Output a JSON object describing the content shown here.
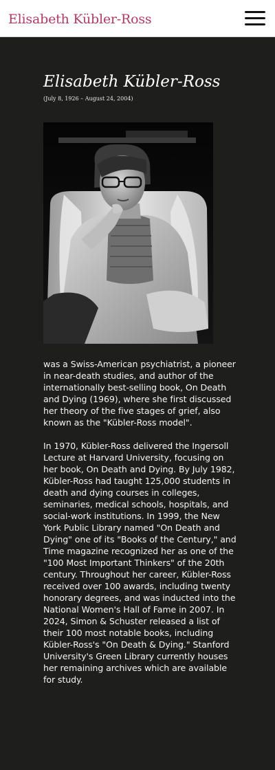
{
  "header": {
    "site_title": "Elisabeth Kübler-Ross",
    "menu_icon": "hamburger-menu-icon"
  },
  "colors": {
    "brand": "#b03a66",
    "background": "#1e1e1c",
    "text": "#f4f4f4"
  },
  "profile": {
    "name": "Elisabeth Kübler-Ross",
    "dates": "(July 8, 1926 – August 24, 2004)"
  },
  "bio": {
    "paragraph_1": "was a Swiss-American psychiatrist, a pioneer in near-death studies, and author of the internationally best-selling book, On Death and Dying (1969), where she first discussed her theory of the five stages of grief, also known as the \"Kübler-Ross model\".",
    "paragraph_2": "In 1970, Kübler-Ross delivered the Ingersoll Lecture at Harvard University, focusing on her book, On Death and Dying. By July 1982, Kübler-Ross had taught 125,000 students in death and dying courses in colleges, seminaries, medical schools, hospitals, and social-work institutions. In 1999, the New York Public Library named \"On Death and Dying\" one of its \"Books of the Century,\"  and Time magazine recognized her as one of the \"100 Most Important Thinkers\" of the 20th century. Throughout her career, Kübler-Ross received over 100 awards, including twenty honorary degrees, and was inducted into the National Women's Hall of Fame in 2007. In 2024, Simon & Schuster released a list of their 100 most notable books, including Kübler-Ross's \"On Death & Dying.\" Stanford University's Green Library currently houses her remaining archives which are available for study."
  }
}
